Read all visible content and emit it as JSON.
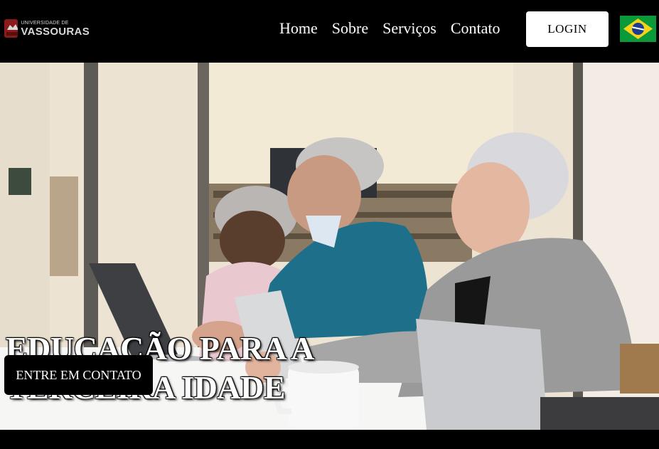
{
  "brand": {
    "logo_small": "UNIVERSIDADE DE",
    "logo_big": "VASSOURAS"
  },
  "nav": {
    "links": [
      "Home",
      "Sobre",
      "Serviços",
      "Contato"
    ],
    "login_label": "LOGIN",
    "flag_icon": "brazil-flag-icon"
  },
  "hero": {
    "title_line1": "EDUCAÇÃO PARA A",
    "title_line2": "TERCEIRA IDADE",
    "cta_label": "ENTRE EM CONTATO"
  },
  "colors": {
    "navbar_bg": "#000000",
    "logo_red": "#8b1a1a",
    "flag_green": "#0b9a3a",
    "flag_yellow": "#f6d31b",
    "flag_blue": "#1a3d8f",
    "sweater_teal": "#1d6f8a",
    "cardigan_gray": "#9a9a9a"
  }
}
